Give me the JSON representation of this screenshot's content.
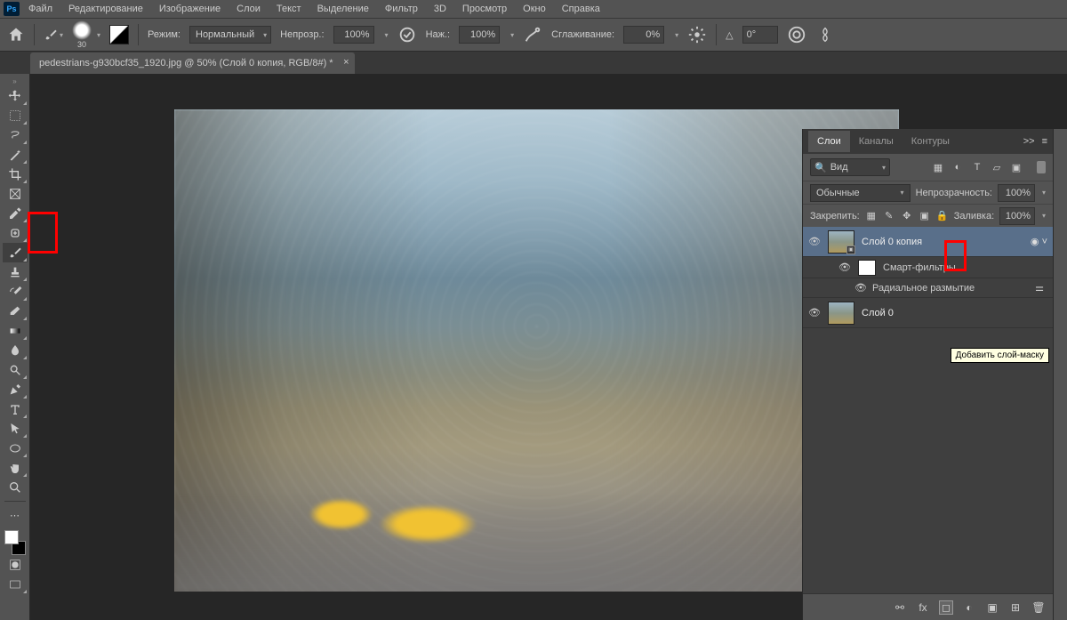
{
  "menu": {
    "items": [
      "Файл",
      "Редактирование",
      "Изображение",
      "Слои",
      "Текст",
      "Выделение",
      "Фильтр",
      "3D",
      "Просмотр",
      "Окно",
      "Справка"
    ]
  },
  "options": {
    "brush_size": "30",
    "mode_label": "Режим:",
    "mode_value": "Нормальный",
    "opacity_label": "Непрозр.:",
    "opacity_value": "100%",
    "flow_label": "Наж.:",
    "flow_value": "100%",
    "smoothing_label": "Сглаживание:",
    "smoothing_value": "0%",
    "angle_symbol": "△",
    "angle_value": "0°"
  },
  "document": {
    "tab_title": "pedestrians-g930bcf35_1920.jpg @ 50% (Слой 0 копия, RGB/8#) *"
  },
  "panels": {
    "tabs": {
      "layers": "Слои",
      "channels": "Каналы",
      "paths": "Контуры"
    },
    "menu_icons": {
      "expand": ">>",
      "menu": "≡"
    },
    "search_placeholder": "Вид",
    "blend": {
      "mode": "Обычные",
      "opacity_label": "Непрозрачность:",
      "opacity_value": "100%"
    },
    "lock": {
      "label": "Закрепить:",
      "fill_label": "Заливка:",
      "fill_value": "100%"
    },
    "layers": [
      {
        "name": "Слой 0 копия",
        "visible": true,
        "smart": true,
        "selected": true
      },
      {
        "smart_filters_label": "Смарт-фильтры"
      },
      {
        "filter_name": "Радиальное размытие"
      },
      {
        "name": "Слой 0",
        "visible": true
      }
    ],
    "footer_icons": {
      "link": "⚯",
      "fx": "fx",
      "mask": "◻",
      "adjust": "◐",
      "group": "▣",
      "new": "⊞",
      "trash": "🗑"
    },
    "tooltip": "Добавить слой-маску"
  }
}
